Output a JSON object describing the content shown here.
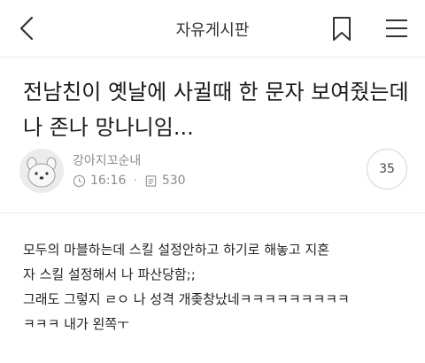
{
  "header": {
    "title": "자유게시판",
    "icons": {
      "back": "chevron-left-icon",
      "bookmark": "bookmark-icon",
      "menu": "hamburger-menu-icon"
    }
  },
  "post": {
    "title": "전남친이 옛날에 사귈때 한 문자 보여줬는데 나 존나 망나니임...",
    "author": "강아지꼬순내",
    "time": "16:16",
    "views": "530",
    "comments": "35",
    "icons": {
      "time": "clock-icon",
      "views": "document-icon",
      "avatar": "dog-avatar-icon"
    },
    "body_lines": [
      "모두의 마블하는데 스킬 설정안하고 하기로 해놓고 지혼",
      "자 스킬 설정해서 나 파산당함;;",
      "그래도 그렇지 ㄹㅇ 나 성격 개좆창났네ㅋㅋㅋㅋㅋㅋㅋㅋㅋ",
      "ㅋㅋㅋ 내가 왼쪽ㅜ"
    ]
  },
  "colors": {
    "text": "#222222",
    "meta": "#8c8c8c",
    "divider": "#ececec"
  }
}
